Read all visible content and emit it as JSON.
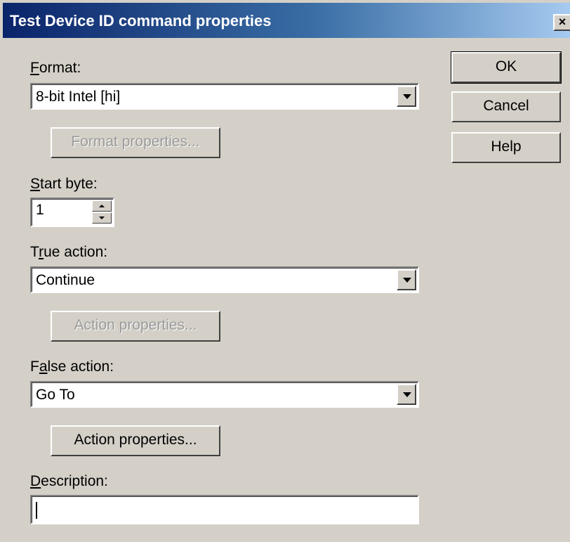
{
  "window": {
    "title": "Test Device ID command properties",
    "close_label": "×"
  },
  "format": {
    "label": "Format:",
    "mnemonic": "F",
    "value": "8-bit Intel  [hi]",
    "properties_button": "Format properties...",
    "properties_enabled": false
  },
  "start_byte": {
    "label": "Start byte:",
    "mnemonic": "S",
    "value": "1"
  },
  "true_action": {
    "label": "True action:",
    "mnemonic": "r",
    "value": "Continue",
    "properties_button": "Action properties...",
    "properties_enabled": false
  },
  "false_action": {
    "label": "False action:",
    "mnemonic": "a",
    "value": "Go To",
    "properties_button": "Action properties...",
    "properties_enabled": true
  },
  "description": {
    "label": "Description:",
    "mnemonic": "D",
    "value": ""
  },
  "buttons": {
    "ok": "OK",
    "cancel": "Cancel",
    "help": "Help"
  },
  "colors": {
    "face": "#d4d0c8",
    "title_start": "#0a246a",
    "title_end": "#a6caf0",
    "disabled_text": "#9a9a9a"
  }
}
